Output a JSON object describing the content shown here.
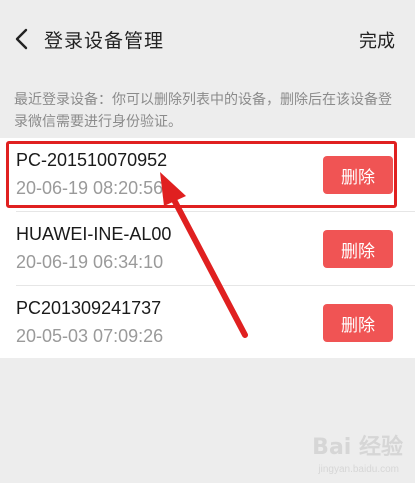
{
  "header": {
    "title": "登录设备管理",
    "done_label": "完成"
  },
  "notice": "最近登录设备：你可以删除列表中的设备，删除后在该设备登录微信需要进行身份验证。",
  "devices": [
    {
      "name": "PC-201510070952",
      "time": "20-06-19 08:20:56",
      "delete_label": "删除"
    },
    {
      "name": "HUAWEI-INE-AL00",
      "time": "20-06-19 06:34:10",
      "delete_label": "删除"
    },
    {
      "name": "PC201309241737",
      "time": "20-05-03 07:09:26",
      "delete_label": "删除"
    }
  ],
  "watermark": {
    "text": "Bai 经验",
    "sub": "jingyan.baidu.com"
  },
  "colors": {
    "delete_button": "#f05454",
    "highlight": "#e02020",
    "background": "#ededed"
  }
}
